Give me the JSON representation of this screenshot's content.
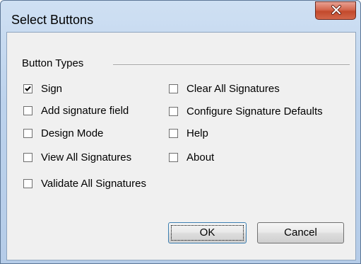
{
  "window": {
    "title": "Select Buttons"
  },
  "group": {
    "label": "Button Types"
  },
  "checkboxes": [
    {
      "label": "Sign",
      "checked": true
    },
    {
      "label": "Add signature field",
      "checked": false
    },
    {
      "label": "Design Mode",
      "checked": false
    },
    {
      "label": "View All Signatures",
      "checked": false
    },
    {
      "label": "Validate All Signatures",
      "checked": false
    },
    {
      "label": "Clear All Signatures",
      "checked": false
    },
    {
      "label": "Configure Signature Defaults",
      "checked": false
    },
    {
      "label": "Help",
      "checked": false
    },
    {
      "label": "About",
      "checked": false
    }
  ],
  "buttons": {
    "ok_label": "OK",
    "cancel_label": "Cancel"
  },
  "icons": {
    "close": "close-icon",
    "check": "checkmark-icon"
  },
  "colors": {
    "close_button": "#c24a2c",
    "title_bar": "#bcd2ec",
    "dialog_background": "#f0f0f0"
  }
}
